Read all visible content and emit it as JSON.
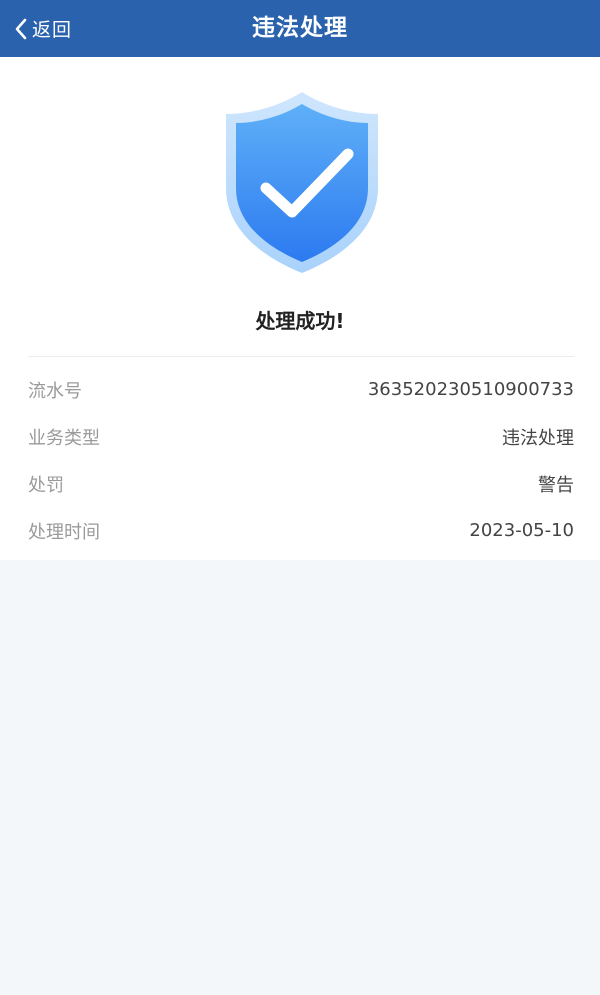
{
  "header": {
    "back_label": "返回",
    "title": "违法处理"
  },
  "result": {
    "title": "处理成功!",
    "icon": "shield-check-icon"
  },
  "details": [
    {
      "label": "流水号",
      "value": "363520230510900733"
    },
    {
      "label": "业务类型",
      "value": "违法处理"
    },
    {
      "label": "处罚",
      "value": "警告"
    },
    {
      "label": "处理时间",
      "value": "2023-05-10"
    }
  ],
  "colors": {
    "header_bg": "#2b62ad",
    "shield_light": "#9fcffa",
    "shield_dark": "#2f7ef0",
    "page_bg": "#f4f7f9"
  }
}
